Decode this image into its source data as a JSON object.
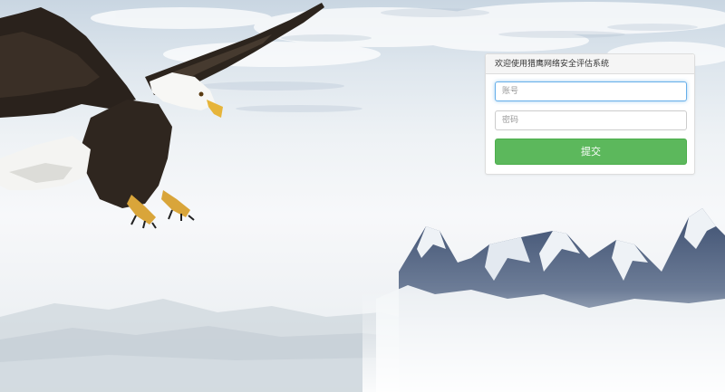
{
  "login": {
    "heading": "欢迎使用猎鹰网络安全评估系统",
    "account_placeholder": "账号",
    "password_placeholder": "密码",
    "submit_label": "提交"
  },
  "colors": {
    "submit_button": "#5cb85c",
    "focus_border": "#66afe9",
    "panel_heading_bg": "#f5f5f5"
  },
  "background": {
    "description_icon": "eagle-over-snowy-mountains"
  }
}
